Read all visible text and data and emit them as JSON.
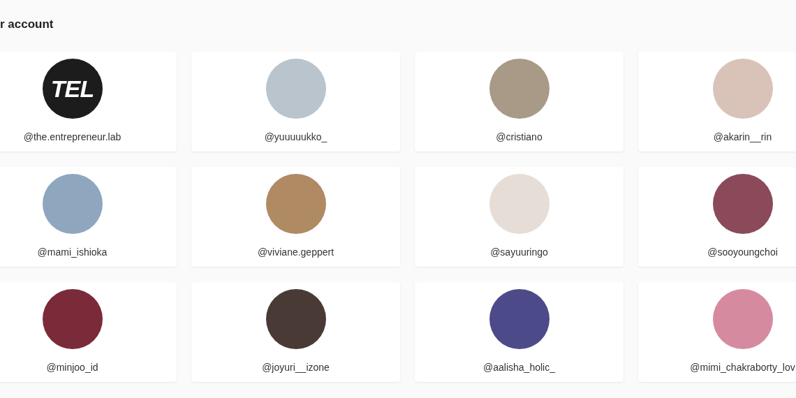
{
  "title": "r account",
  "accounts": [
    {
      "handle": "@the.entrepreneur.lab",
      "kind": "logo",
      "logo_text": "TEL"
    },
    {
      "handle": "@yuuuuukko_",
      "kind": "photo",
      "color": "#b9c4cc"
    },
    {
      "handle": "@cristiano",
      "kind": "photo",
      "color": "#a89a86"
    },
    {
      "handle": "@akarin__rin",
      "kind": "photo",
      "color": "#d9c3b8"
    },
    {
      "handle": "@mami_ishioka",
      "kind": "photo",
      "color": "#8fa6bf"
    },
    {
      "handle": "@viviane.geppert",
      "kind": "photo",
      "color": "#b08a63"
    },
    {
      "handle": "@sayuuringo",
      "kind": "photo",
      "color": "#e6ddd6"
    },
    {
      "handle": "@sooyoungchoi",
      "kind": "photo",
      "color": "#8a4a5a"
    },
    {
      "handle": "@minjoo_id",
      "kind": "photo",
      "color": "#7a2a38"
    },
    {
      "handle": "@joyuri__izone",
      "kind": "photo",
      "color": "#4a3a36"
    },
    {
      "handle": "@aalisha_holic_",
      "kind": "photo",
      "color": "#4d4a8a"
    },
    {
      "handle": "@mimi_chakraborty_lov",
      "kind": "photo",
      "color": "#d68aa0"
    }
  ]
}
